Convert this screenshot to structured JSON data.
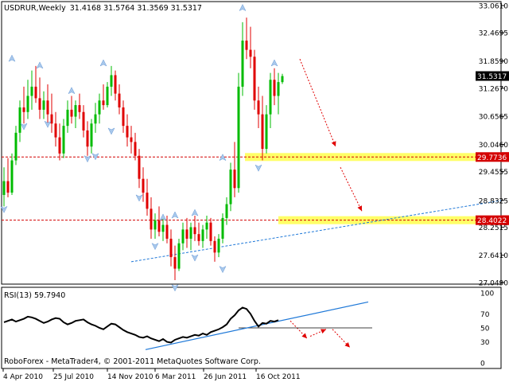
{
  "header": {
    "symbol": "USDRUR,Weekly",
    "ohlc": "31.4168 31.5764 31.3569 31.5317"
  },
  "footer": {
    "copyright": "RoboForex - MetaTrader4, © 2001-2011 MetaQuotes Software Corp."
  },
  "chart_data": [
    {
      "type": "candlestick",
      "title": "USDRUR,Weekly",
      "ylim": [
        27.049,
        33.061
      ],
      "y_ticks": [
        "33.0610",
        "32.4695",
        "31.8590",
        "31.2670",
        "30.6565",
        "30.0460",
        "29.4555",
        "28.8325",
        "28.2515",
        "27.6410",
        "27.0490"
      ],
      "x_ticks": [
        "4 Apr 2010",
        "25 Jul 2010",
        "14 Nov 2010",
        "6 Mar 2011",
        "26 Jun 2011",
        "16 Oct 2011"
      ],
      "current_price": "31.5317",
      "levels": [
        {
          "label": "29.7736",
          "value": 29.7736,
          "color": "#d40000"
        },
        {
          "label": "28.4022",
          "value": 28.4022,
          "color": "#d40000"
        }
      ],
      "candles": [
        {
          "o": 28.95,
          "h": 29.55,
          "l": 28.7,
          "c": 29.25
        },
        {
          "o": 29.25,
          "h": 29.75,
          "l": 28.9,
          "c": 29.0
        },
        {
          "o": 29.0,
          "h": 29.85,
          "l": 28.95,
          "c": 29.7
        },
        {
          "o": 29.7,
          "h": 30.45,
          "l": 29.6,
          "c": 30.3
        },
        {
          "o": 30.3,
          "h": 31.0,
          "l": 30.1,
          "c": 30.85
        },
        {
          "o": 30.85,
          "h": 31.3,
          "l": 30.5,
          "c": 30.75
        },
        {
          "o": 30.75,
          "h": 31.45,
          "l": 30.6,
          "c": 31.1
        },
        {
          "o": 31.1,
          "h": 31.65,
          "l": 30.8,
          "c": 31.3
        },
        {
          "o": 31.3,
          "h": 31.75,
          "l": 30.95,
          "c": 31.05
        },
        {
          "o": 31.05,
          "h": 31.5,
          "l": 30.6,
          "c": 30.8
        },
        {
          "o": 30.8,
          "h": 31.2,
          "l": 30.6,
          "c": 31.0
        },
        {
          "o": 31.0,
          "h": 31.35,
          "l": 30.5,
          "c": 30.7
        },
        {
          "o": 30.7,
          "h": 31.15,
          "l": 30.3,
          "c": 30.5
        },
        {
          "o": 30.5,
          "h": 30.75,
          "l": 30.0,
          "c": 30.2
        },
        {
          "o": 30.2,
          "h": 30.5,
          "l": 29.7,
          "c": 29.85
        },
        {
          "o": 29.85,
          "h": 30.6,
          "l": 29.75,
          "c": 30.45
        },
        {
          "o": 30.45,
          "h": 31.0,
          "l": 30.3,
          "c": 30.8
        },
        {
          "o": 30.8,
          "h": 31.1,
          "l": 30.5,
          "c": 30.65
        },
        {
          "o": 30.65,
          "h": 31.0,
          "l": 30.4,
          "c": 30.9
        },
        {
          "o": 30.9,
          "h": 31.15,
          "l": 30.6,
          "c": 30.75
        },
        {
          "o": 30.75,
          "h": 30.9,
          "l": 30.2,
          "c": 30.35
        },
        {
          "o": 30.35,
          "h": 30.55,
          "l": 29.8,
          "c": 30.0
        },
        {
          "o": 30.0,
          "h": 30.6,
          "l": 29.85,
          "c": 30.5
        },
        {
          "o": 30.5,
          "h": 30.95,
          "l": 30.3,
          "c": 30.7
        },
        {
          "o": 30.7,
          "h": 31.15,
          "l": 30.5,
          "c": 31.0
        },
        {
          "o": 31.0,
          "h": 31.35,
          "l": 30.8,
          "c": 30.9
        },
        {
          "o": 30.9,
          "h": 31.4,
          "l": 30.85,
          "c": 31.3
        },
        {
          "o": 31.3,
          "h": 31.75,
          "l": 31.1,
          "c": 31.55
        },
        {
          "o": 31.55,
          "h": 31.65,
          "l": 31.0,
          "c": 31.15
        },
        {
          "o": 31.15,
          "h": 31.35,
          "l": 30.7,
          "c": 30.85
        },
        {
          "o": 30.85,
          "h": 31.0,
          "l": 30.3,
          "c": 30.45
        },
        {
          "o": 30.45,
          "h": 30.7,
          "l": 30.0,
          "c": 30.2
        },
        {
          "o": 30.2,
          "h": 30.45,
          "l": 29.85,
          "c": 30.1
        },
        {
          "o": 30.1,
          "h": 30.3,
          "l": 29.7,
          "c": 29.8
        },
        {
          "o": 29.8,
          "h": 29.95,
          "l": 29.1,
          "c": 29.3
        },
        {
          "o": 29.3,
          "h": 29.55,
          "l": 28.8,
          "c": 29.0
        },
        {
          "o": 29.0,
          "h": 29.3,
          "l": 28.5,
          "c": 28.65
        },
        {
          "o": 28.65,
          "h": 28.9,
          "l": 28.0,
          "c": 28.2
        },
        {
          "o": 28.2,
          "h": 28.55,
          "l": 28.0,
          "c": 28.4
        },
        {
          "o": 28.4,
          "h": 28.7,
          "l": 28.05,
          "c": 28.15
        },
        {
          "o": 28.15,
          "h": 28.45,
          "l": 27.95,
          "c": 28.3
        },
        {
          "o": 28.3,
          "h": 28.5,
          "l": 27.9,
          "c": 28.0
        },
        {
          "o": 28.0,
          "h": 28.2,
          "l": 27.4,
          "c": 27.6
        },
        {
          "o": 27.6,
          "h": 27.85,
          "l": 27.1,
          "c": 27.35
        },
        {
          "o": 27.35,
          "h": 28.0,
          "l": 27.3,
          "c": 27.9
        },
        {
          "o": 27.9,
          "h": 28.35,
          "l": 27.75,
          "c": 28.2
        },
        {
          "o": 28.2,
          "h": 28.45,
          "l": 27.8,
          "c": 28.0
        },
        {
          "o": 28.0,
          "h": 28.35,
          "l": 27.75,
          "c": 28.25
        },
        {
          "o": 28.25,
          "h": 28.5,
          "l": 27.95,
          "c": 28.1
        },
        {
          "o": 28.1,
          "h": 28.35,
          "l": 27.85,
          "c": 27.95
        },
        {
          "o": 27.95,
          "h": 28.3,
          "l": 27.8,
          "c": 28.2
        },
        {
          "o": 28.2,
          "h": 28.5,
          "l": 28.0,
          "c": 28.35
        },
        {
          "o": 28.35,
          "h": 28.45,
          "l": 27.85,
          "c": 27.95
        },
        {
          "o": 27.95,
          "h": 28.05,
          "l": 27.5,
          "c": 27.7
        },
        {
          "o": 27.7,
          "h": 28.1,
          "l": 27.6,
          "c": 28.0
        },
        {
          "o": 28.0,
          "h": 28.55,
          "l": 27.9,
          "c": 28.45
        },
        {
          "o": 28.45,
          "h": 28.9,
          "l": 28.3,
          "c": 28.75
        },
        {
          "o": 28.75,
          "h": 29.65,
          "l": 28.6,
          "c": 29.5
        },
        {
          "o": 29.5,
          "h": 30.1,
          "l": 28.9,
          "c": 29.1
        },
        {
          "o": 29.1,
          "h": 31.6,
          "l": 29.0,
          "c": 31.3
        },
        {
          "o": 31.3,
          "h": 32.7,
          "l": 31.1,
          "c": 32.3
        },
        {
          "o": 32.3,
          "h": 32.8,
          "l": 31.9,
          "c": 32.1
        },
        {
          "o": 32.1,
          "h": 32.6,
          "l": 31.7,
          "c": 31.95
        },
        {
          "o": 31.95,
          "h": 32.1,
          "l": 30.8,
          "c": 31.0
        },
        {
          "o": 31.0,
          "h": 31.3,
          "l": 30.4,
          "c": 30.7
        },
        {
          "o": 30.7,
          "h": 31.1,
          "l": 29.7,
          "c": 29.95
        },
        {
          "o": 29.95,
          "h": 30.9,
          "l": 29.85,
          "c": 30.7
        },
        {
          "o": 30.7,
          "h": 31.6,
          "l": 30.4,
          "c": 31.45
        },
        {
          "o": 31.45,
          "h": 31.7,
          "l": 30.9,
          "c": 31.1
        },
        {
          "o": 31.1,
          "h": 31.6,
          "l": 30.7,
          "c": 31.4
        },
        {
          "o": 31.4,
          "h": 31.58,
          "l": 31.36,
          "c": 31.53
        }
      ],
      "fractals_up": [
        [
          2,
          31.9
        ],
        [
          9,
          31.75
        ],
        [
          17,
          31.2
        ],
        [
          25,
          31.8
        ],
        [
          40,
          28.45
        ],
        [
          43,
          28.5
        ],
        [
          48,
          28.55
        ],
        [
          55,
          29.75
        ],
        [
          60,
          33.0
        ],
        [
          68,
          31.8
        ]
      ],
      "fractals_down": [
        [
          0,
          28.65
        ],
        [
          5,
          30.45
        ],
        [
          11,
          30.5
        ],
        [
          21,
          29.75
        ],
        [
          23,
          29.8
        ],
        [
          27,
          30.35
        ],
        [
          34,
          28.9
        ],
        [
          38,
          27.85
        ],
        [
          43,
          26.95
        ],
        [
          48,
          27.6
        ],
        [
          55,
          27.35
        ],
        [
          64,
          29.55
        ]
      ]
    },
    {
      "type": "line",
      "title": "RSI(13) 59.7940",
      "ylim": [
        0,
        100
      ],
      "y_ticks": [
        "100",
        "70",
        "50",
        "30",
        "0"
      ],
      "values": [
        58,
        60,
        62,
        59,
        61,
        63,
        66,
        65,
        63,
        60,
        57,
        59,
        62,
        64,
        63,
        58,
        55,
        57,
        60,
        61,
        62,
        58,
        55,
        53,
        50,
        48,
        52,
        56,
        55,
        51,
        47,
        44,
        42,
        40,
        37,
        36,
        38,
        35,
        33,
        31,
        34,
        30,
        29,
        33,
        35,
        37,
        36,
        38,
        40,
        39,
        42,
        40,
        44,
        46,
        48,
        51,
        55,
        63,
        68,
        75,
        79,
        77,
        70,
        60,
        52,
        57,
        56,
        60,
        59,
        61
      ]
    }
  ]
}
